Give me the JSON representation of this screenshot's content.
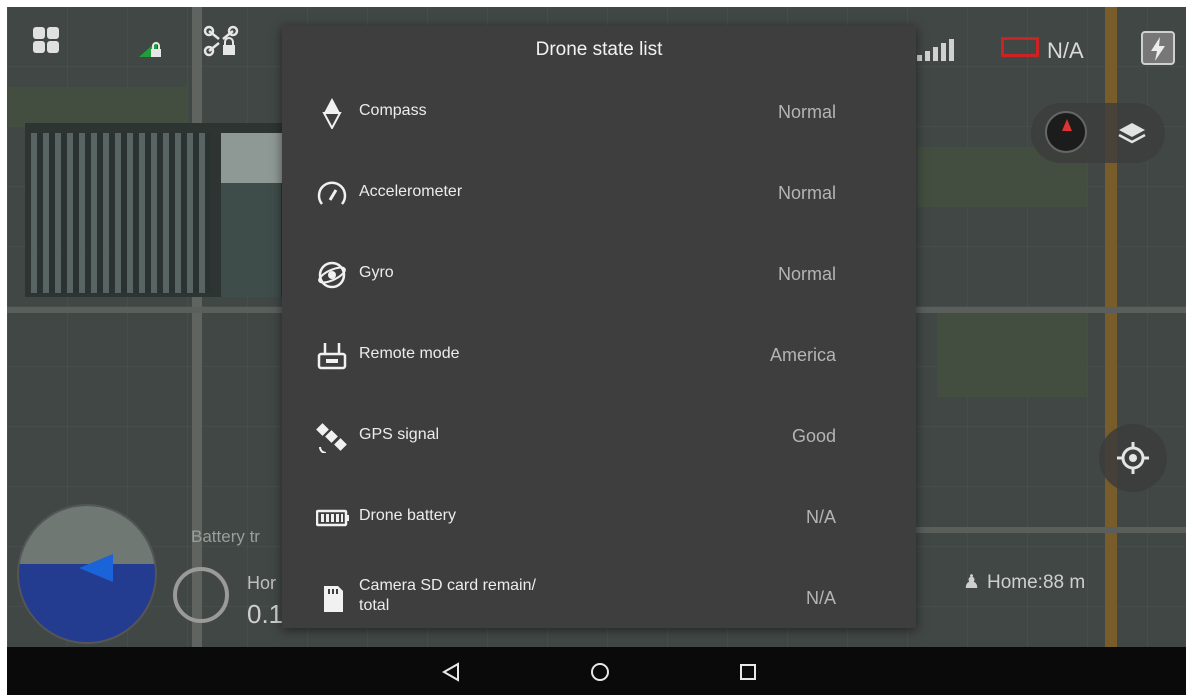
{
  "dialog": {
    "title": "Drone state list",
    "rows": [
      {
        "label": "Compass",
        "value": "Normal",
        "icon": "compass-icon"
      },
      {
        "label": "Accelerometer",
        "value": "Normal",
        "icon": "speedometer-icon"
      },
      {
        "label": "Gyro",
        "value": "Normal",
        "icon": "gyro-icon"
      },
      {
        "label": "Remote mode",
        "value": "America",
        "icon": "remote-controller-icon"
      },
      {
        "label": "GPS signal",
        "value": "Good",
        "icon": "satellite-icon"
      },
      {
        "label": "Drone battery",
        "value": "N/A",
        "icon": "battery-icon"
      },
      {
        "label": "Camera SD card remain/\ntotal",
        "value": "N/A",
        "icon": "sd-card-icon"
      }
    ]
  },
  "topbar": {
    "battery_status": "N/A",
    "icons": [
      "apps-icon",
      "signal-lock-icon",
      "drone-lock-icon",
      "signal-bars-icon",
      "battery-icon",
      "flash-icon"
    ]
  },
  "overlay": {
    "battery_tip": "Battery tr",
    "home_label": "Hor",
    "home_value": "0.1",
    "home_distance": "Home:88 m"
  },
  "navbar": {
    "icons": [
      "back-icon",
      "home-icon",
      "recents-icon"
    ]
  }
}
